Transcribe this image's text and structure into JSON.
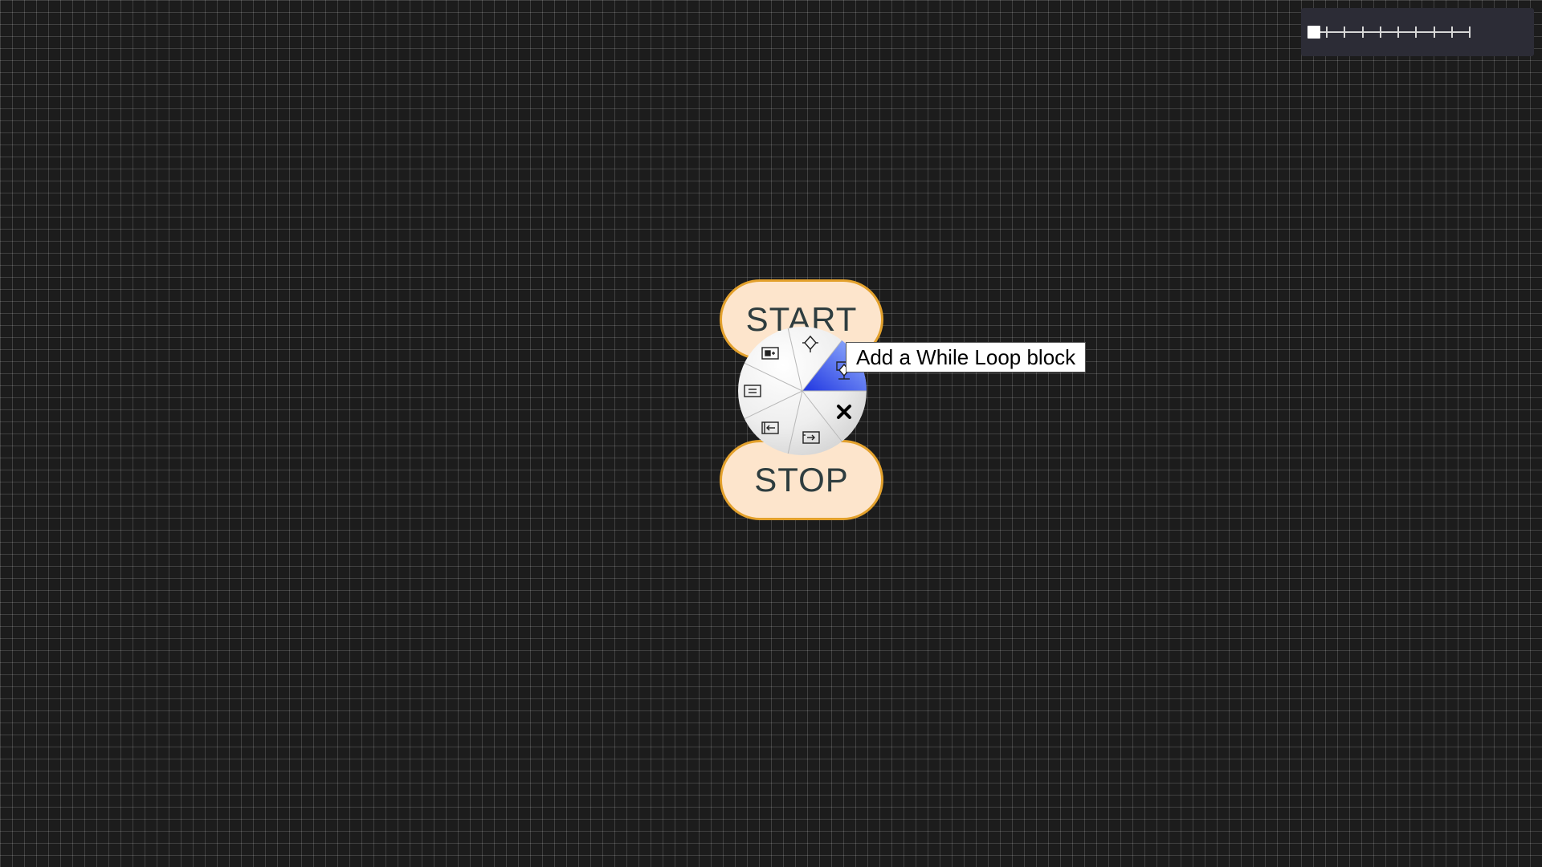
{
  "flowchart": {
    "start_label": "START",
    "stop_label": "STOP"
  },
  "radial_menu": {
    "icons": [
      "if-block-icon",
      "while-loop-icon",
      "close-icon",
      "output-block-icon",
      "input-block-icon",
      "process-block-icon",
      "call-block-icon"
    ],
    "highlight_color": "#1f35e0",
    "tooltip": "Add a While Loop block"
  },
  "zoom": {
    "level": 0,
    "steps": 10
  }
}
